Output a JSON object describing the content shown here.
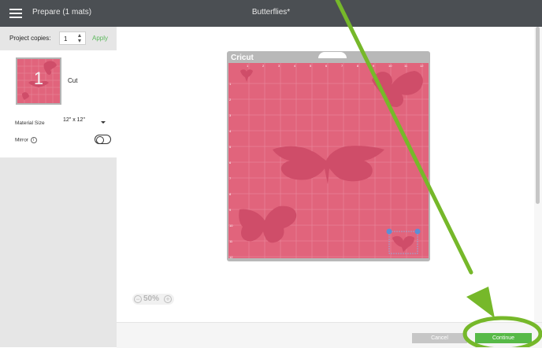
{
  "header": {
    "menu_icon": "hamburger-icon",
    "prepare_title": "Prepare (1 mats)",
    "project_name": "Butterflies*"
  },
  "sidebar": {
    "copies_label": "Project copies:",
    "copies_value": "1",
    "apply_label": "Apply",
    "mat": {
      "number": "1",
      "operation": "Cut"
    },
    "material_size_label": "Material Size",
    "material_size_value": "12\" x 12\"",
    "mirror_label": "Mirror",
    "mirror_on": false
  },
  "canvas": {
    "brand": "Cricut",
    "ruler_top": [
      "1",
      "2",
      "3",
      "4",
      "5",
      "6",
      "7",
      "8",
      "9",
      "10",
      "11",
      "12"
    ],
    "ruler_left": [
      "1",
      "2",
      "3",
      "4",
      "5",
      "6",
      "7",
      "8",
      "9",
      "10",
      "11",
      "12"
    ],
    "mat_color": "#e1647c",
    "shape_color": "#cf4d69",
    "zoom_minus": "−",
    "zoom_level": "50%",
    "zoom_plus": "+"
  },
  "footer": {
    "cancel_label": "Cancel",
    "continue_label": "Continue"
  },
  "annotation": {
    "color": "#76b82a",
    "icon": "arrow-annotation"
  }
}
